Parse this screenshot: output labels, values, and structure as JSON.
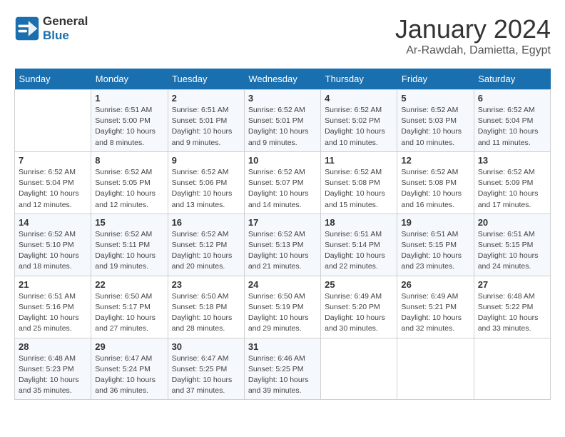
{
  "header": {
    "logo_line1": "General",
    "logo_line2": "Blue",
    "month": "January 2024",
    "location": "Ar-Rawdah, Damietta, Egypt"
  },
  "weekdays": [
    "Sunday",
    "Monday",
    "Tuesday",
    "Wednesday",
    "Thursday",
    "Friday",
    "Saturday"
  ],
  "weeks": [
    [
      {
        "num": "",
        "info": ""
      },
      {
        "num": "1",
        "info": "Sunrise: 6:51 AM\nSunset: 5:00 PM\nDaylight: 10 hours\nand 8 minutes."
      },
      {
        "num": "2",
        "info": "Sunrise: 6:51 AM\nSunset: 5:01 PM\nDaylight: 10 hours\nand 9 minutes."
      },
      {
        "num": "3",
        "info": "Sunrise: 6:52 AM\nSunset: 5:01 PM\nDaylight: 10 hours\nand 9 minutes."
      },
      {
        "num": "4",
        "info": "Sunrise: 6:52 AM\nSunset: 5:02 PM\nDaylight: 10 hours\nand 10 minutes."
      },
      {
        "num": "5",
        "info": "Sunrise: 6:52 AM\nSunset: 5:03 PM\nDaylight: 10 hours\nand 10 minutes."
      },
      {
        "num": "6",
        "info": "Sunrise: 6:52 AM\nSunset: 5:04 PM\nDaylight: 10 hours\nand 11 minutes."
      }
    ],
    [
      {
        "num": "7",
        "info": "Sunrise: 6:52 AM\nSunset: 5:04 PM\nDaylight: 10 hours\nand 12 minutes."
      },
      {
        "num": "8",
        "info": "Sunrise: 6:52 AM\nSunset: 5:05 PM\nDaylight: 10 hours\nand 12 minutes."
      },
      {
        "num": "9",
        "info": "Sunrise: 6:52 AM\nSunset: 5:06 PM\nDaylight: 10 hours\nand 13 minutes."
      },
      {
        "num": "10",
        "info": "Sunrise: 6:52 AM\nSunset: 5:07 PM\nDaylight: 10 hours\nand 14 minutes."
      },
      {
        "num": "11",
        "info": "Sunrise: 6:52 AM\nSunset: 5:08 PM\nDaylight: 10 hours\nand 15 minutes."
      },
      {
        "num": "12",
        "info": "Sunrise: 6:52 AM\nSunset: 5:08 PM\nDaylight: 10 hours\nand 16 minutes."
      },
      {
        "num": "13",
        "info": "Sunrise: 6:52 AM\nSunset: 5:09 PM\nDaylight: 10 hours\nand 17 minutes."
      }
    ],
    [
      {
        "num": "14",
        "info": "Sunrise: 6:52 AM\nSunset: 5:10 PM\nDaylight: 10 hours\nand 18 minutes."
      },
      {
        "num": "15",
        "info": "Sunrise: 6:52 AM\nSunset: 5:11 PM\nDaylight: 10 hours\nand 19 minutes."
      },
      {
        "num": "16",
        "info": "Sunrise: 6:52 AM\nSunset: 5:12 PM\nDaylight: 10 hours\nand 20 minutes."
      },
      {
        "num": "17",
        "info": "Sunrise: 6:52 AM\nSunset: 5:13 PM\nDaylight: 10 hours\nand 21 minutes."
      },
      {
        "num": "18",
        "info": "Sunrise: 6:51 AM\nSunset: 5:14 PM\nDaylight: 10 hours\nand 22 minutes."
      },
      {
        "num": "19",
        "info": "Sunrise: 6:51 AM\nSunset: 5:15 PM\nDaylight: 10 hours\nand 23 minutes."
      },
      {
        "num": "20",
        "info": "Sunrise: 6:51 AM\nSunset: 5:15 PM\nDaylight: 10 hours\nand 24 minutes."
      }
    ],
    [
      {
        "num": "21",
        "info": "Sunrise: 6:51 AM\nSunset: 5:16 PM\nDaylight: 10 hours\nand 25 minutes."
      },
      {
        "num": "22",
        "info": "Sunrise: 6:50 AM\nSunset: 5:17 PM\nDaylight: 10 hours\nand 27 minutes."
      },
      {
        "num": "23",
        "info": "Sunrise: 6:50 AM\nSunset: 5:18 PM\nDaylight: 10 hours\nand 28 minutes."
      },
      {
        "num": "24",
        "info": "Sunrise: 6:50 AM\nSunset: 5:19 PM\nDaylight: 10 hours\nand 29 minutes."
      },
      {
        "num": "25",
        "info": "Sunrise: 6:49 AM\nSunset: 5:20 PM\nDaylight: 10 hours\nand 30 minutes."
      },
      {
        "num": "26",
        "info": "Sunrise: 6:49 AM\nSunset: 5:21 PM\nDaylight: 10 hours\nand 32 minutes."
      },
      {
        "num": "27",
        "info": "Sunrise: 6:48 AM\nSunset: 5:22 PM\nDaylight: 10 hours\nand 33 minutes."
      }
    ],
    [
      {
        "num": "28",
        "info": "Sunrise: 6:48 AM\nSunset: 5:23 PM\nDaylight: 10 hours\nand 35 minutes."
      },
      {
        "num": "29",
        "info": "Sunrise: 6:47 AM\nSunset: 5:24 PM\nDaylight: 10 hours\nand 36 minutes."
      },
      {
        "num": "30",
        "info": "Sunrise: 6:47 AM\nSunset: 5:25 PM\nDaylight: 10 hours\nand 37 minutes."
      },
      {
        "num": "31",
        "info": "Sunrise: 6:46 AM\nSunset: 5:25 PM\nDaylight: 10 hours\nand 39 minutes."
      },
      {
        "num": "",
        "info": ""
      },
      {
        "num": "",
        "info": ""
      },
      {
        "num": "",
        "info": ""
      }
    ]
  ]
}
